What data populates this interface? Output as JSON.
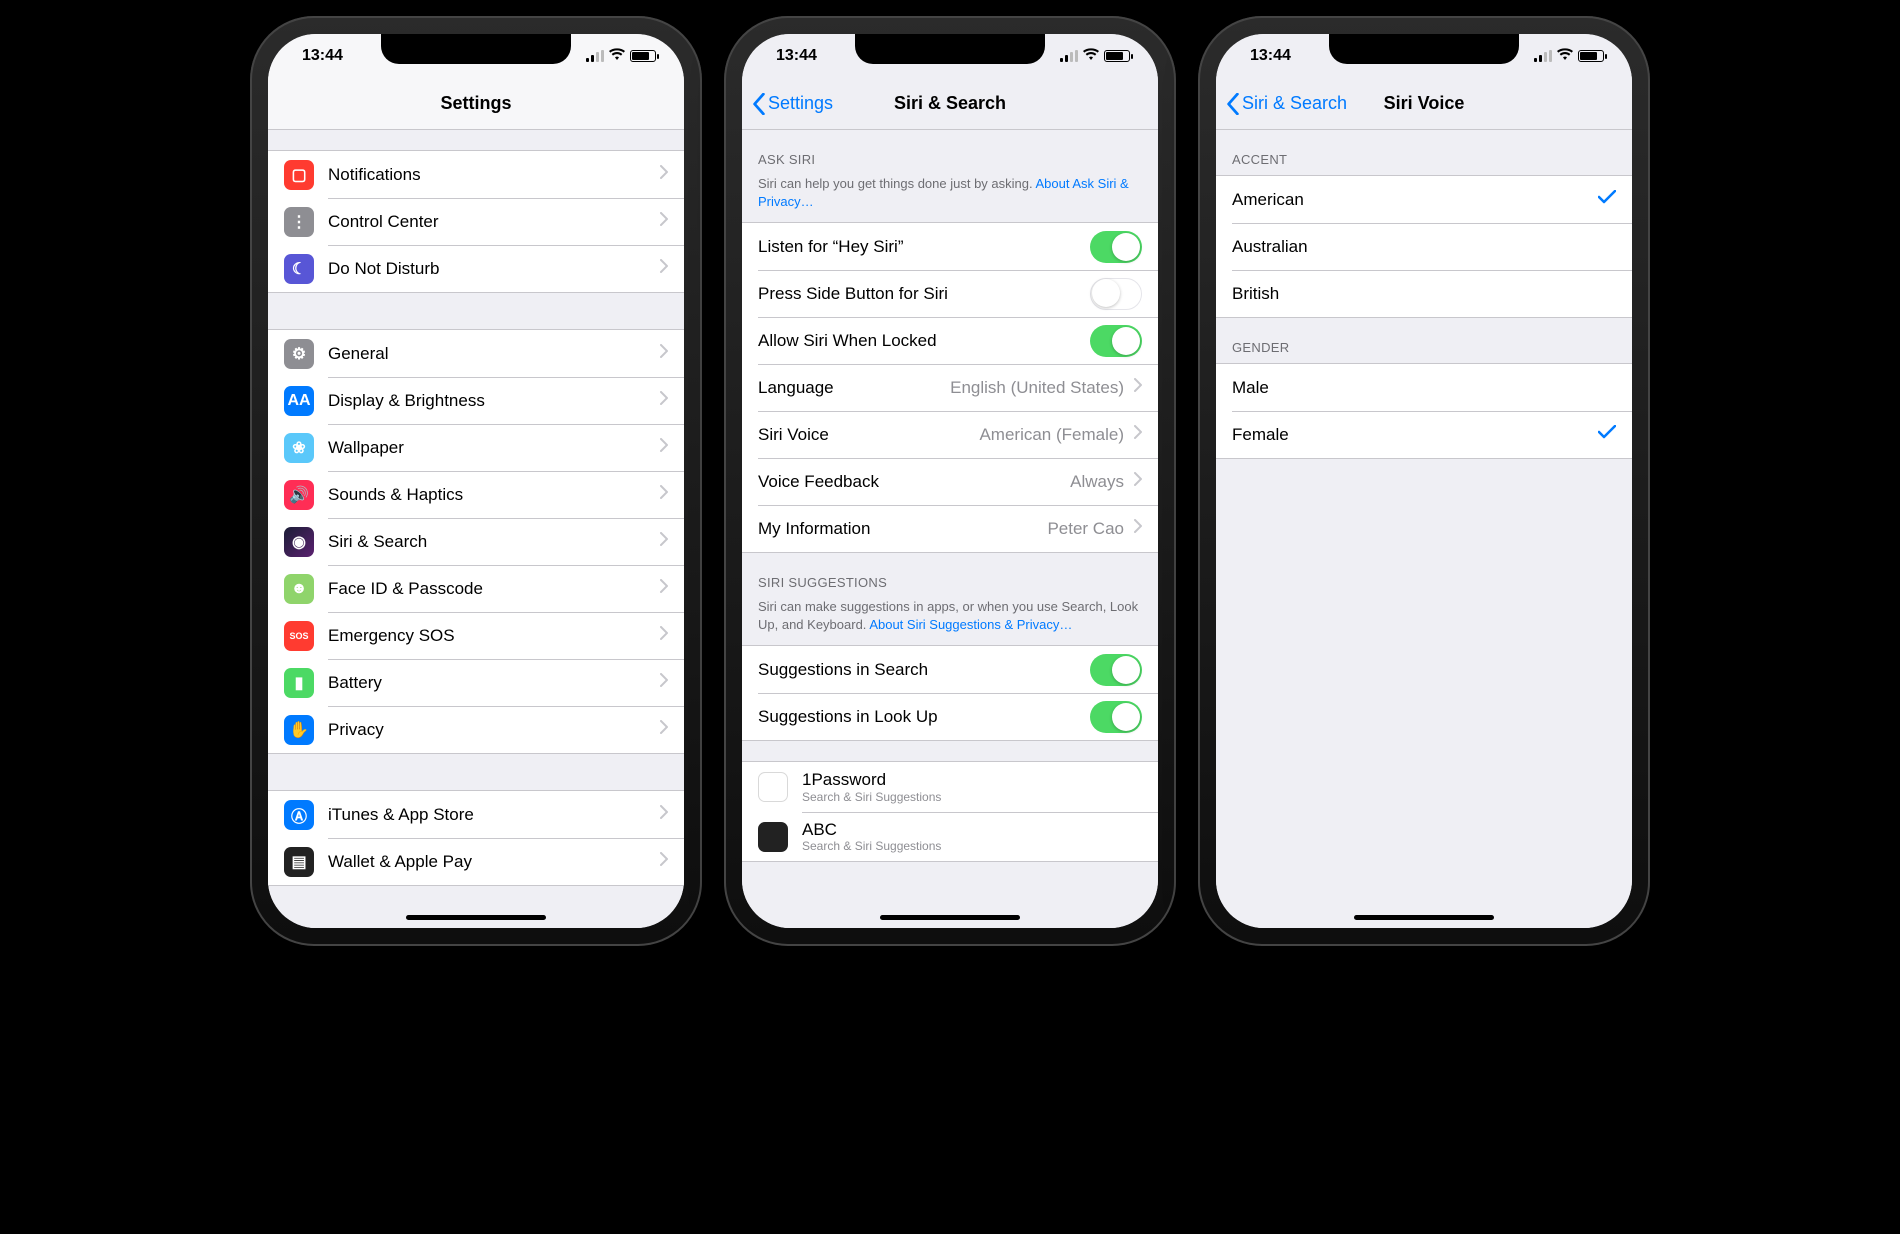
{
  "statusbar": {
    "time": "13:44"
  },
  "screen1": {
    "title": "Settings",
    "groupA": [
      {
        "label": "Notifications",
        "iconClass": "bg-red",
        "glyph": "▢"
      },
      {
        "label": "Control Center",
        "iconClass": "bg-grey",
        "glyph": "⋮"
      },
      {
        "label": "Do Not Disturb",
        "iconClass": "bg-purple",
        "glyph": "☾"
      }
    ],
    "groupB": [
      {
        "label": "General",
        "iconClass": "bg-grey",
        "glyph": "⚙"
      },
      {
        "label": "Display & Brightness",
        "iconClass": "bg-blue",
        "glyph": "AA"
      },
      {
        "label": "Wallpaper",
        "iconClass": "bg-cyan",
        "glyph": "❀"
      },
      {
        "label": "Sounds & Haptics",
        "iconClass": "bg-pink",
        "glyph": "🔊"
      },
      {
        "label": "Siri & Search",
        "iconClass": "bg-siri",
        "glyph": "◉"
      },
      {
        "label": "Face ID & Passcode",
        "iconClass": "bg-lime",
        "glyph": "☻"
      },
      {
        "label": "Emergency SOS",
        "iconClass": "bg-red",
        "glyph": "SOS"
      },
      {
        "label": "Battery",
        "iconClass": "bg-green",
        "glyph": "▮"
      },
      {
        "label": "Privacy",
        "iconClass": "bg-blue",
        "glyph": "✋"
      }
    ],
    "groupC": [
      {
        "label": "iTunes & App Store",
        "iconClass": "bg-blue",
        "glyph": "Ⓐ"
      },
      {
        "label": "Wallet & Apple Pay",
        "iconClass": "bg-dark",
        "glyph": "▤"
      }
    ]
  },
  "screen2": {
    "back": "Settings",
    "title": "Siri & Search",
    "askSiri": {
      "header": "ASK SIRI",
      "footer": "Siri can help you get things done just by asking. ",
      "footerLink": "About Ask Siri & Privacy…",
      "rows": {
        "listen": {
          "label": "Listen for “Hey Siri”",
          "on": true
        },
        "press": {
          "label": "Press Side Button for Siri",
          "on": false
        },
        "locked": {
          "label": "Allow Siri When Locked",
          "on": true
        },
        "language": {
          "label": "Language",
          "value": "English (United States)"
        },
        "voice": {
          "label": "Siri Voice",
          "value": "American (Female)"
        },
        "feedback": {
          "label": "Voice Feedback",
          "value": "Always"
        },
        "myinfo": {
          "label": "My Information",
          "value": "Peter Cao"
        }
      }
    },
    "suggestions": {
      "header": "SIRI SUGGESTIONS",
      "footer": "Siri can make suggestions in apps, or when you use Search, Look Up, and Keyboard. ",
      "footerLink": "About Siri Suggestions & Privacy…",
      "rows": {
        "search": {
          "label": "Suggestions in Search",
          "on": true
        },
        "lookup": {
          "label": "Suggestions in Look Up",
          "on": true
        }
      }
    },
    "apps": [
      {
        "name": "1Password",
        "sub": "Search & Siri Suggestions",
        "iconClass": "bg-white"
      },
      {
        "name": "ABC",
        "sub": "Search & Siri Suggestions",
        "iconClass": "bg-dark"
      }
    ]
  },
  "screen3": {
    "back": "Siri & Search",
    "title": "Siri Voice",
    "accent": {
      "header": "ACCENT",
      "options": [
        {
          "label": "American",
          "selected": true
        },
        {
          "label": "Australian",
          "selected": false
        },
        {
          "label": "British",
          "selected": false
        }
      ]
    },
    "gender": {
      "header": "GENDER",
      "options": [
        {
          "label": "Male",
          "selected": false
        },
        {
          "label": "Female",
          "selected": true
        }
      ]
    }
  }
}
